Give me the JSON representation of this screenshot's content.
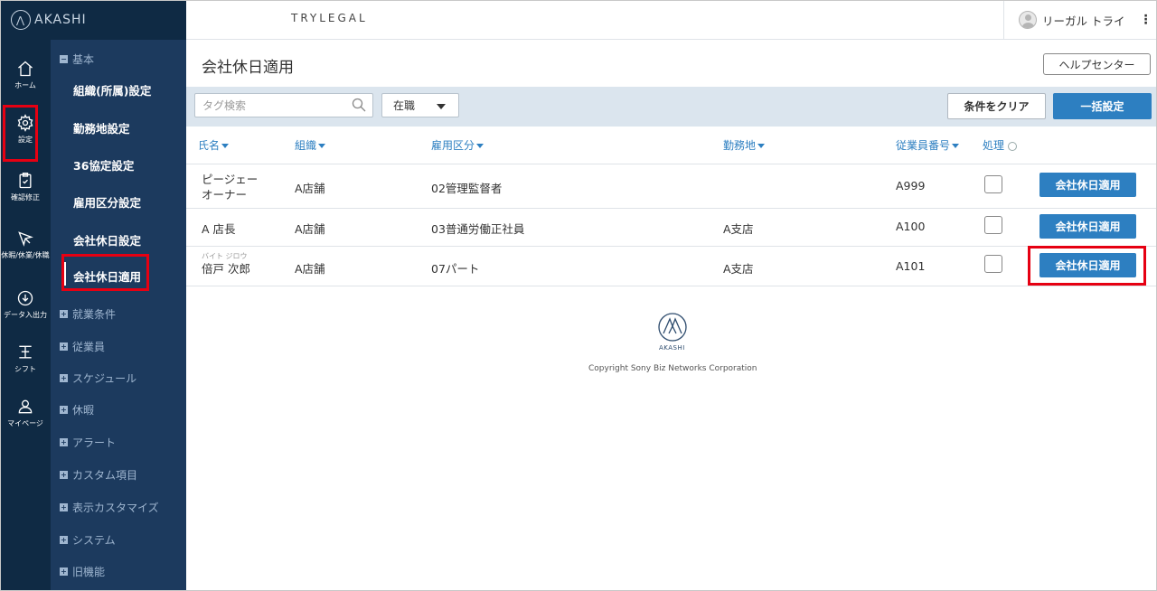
{
  "app": {
    "brand": "AKASHI",
    "company": "TRYLEGAL"
  },
  "user": {
    "name": "リーガル トライ",
    "menu_icon": "kebab-icon"
  },
  "rail": {
    "items": [
      {
        "label": "ホーム",
        "icon": "home-icon"
      },
      {
        "label": "設定",
        "icon": "gear-icon"
      },
      {
        "label": "確認修正",
        "icon": "clipboard-icon"
      },
      {
        "label": "休暇/休業/休職",
        "icon": "plane-icon"
      },
      {
        "label": "データ入出力",
        "icon": "download-icon"
      },
      {
        "label": "シフト",
        "icon": "shift-icon"
      },
      {
        "label": "マイページ",
        "icon": "person-icon"
      }
    ]
  },
  "subnav": {
    "section_basic": "基本",
    "items": [
      "組織(所属)設定",
      "勤務地設定",
      "36協定設定",
      "雇用区分設定",
      "会社休日設定",
      "会社休日適用"
    ],
    "sections": [
      "就業条件",
      "従業員",
      "スケジュール",
      "休暇",
      "アラート",
      "カスタム項目",
      "表示カスタマイズ",
      "システム",
      "旧機能"
    ]
  },
  "page": {
    "title": "会社休日適用",
    "help_label": "ヘルプセンター"
  },
  "filters": {
    "search_placeholder": "タグ検索",
    "status_value": "在職",
    "clear_label": "条件をクリア",
    "bulk_label": "一括設定"
  },
  "table": {
    "headers": {
      "name": "氏名",
      "org": "組織",
      "employment": "雇用区分",
      "workplace": "勤務地",
      "emp_no": "従業員番号",
      "process": "処理"
    },
    "rows": [
      {
        "ruby": "",
        "name_line1": "ピージェー",
        "name_line2": "オーナー",
        "org": "A店舗",
        "employment": "02管理監督者",
        "workplace": "",
        "emp_no": "A999",
        "action": "会社休日適用"
      },
      {
        "ruby": "",
        "name_line1": "A 店長",
        "name_line2": "",
        "org": "A店舗",
        "employment": "03普通労働正社員",
        "workplace": "A支店",
        "emp_no": "A100",
        "action": "会社休日適用"
      },
      {
        "ruby": "バイト ジロウ",
        "name_line1": "倍戸 次郎",
        "name_line2": "",
        "org": "A店舗",
        "employment": "07パート",
        "workplace": "A支店",
        "emp_no": "A101",
        "action": "会社休日適用"
      }
    ]
  },
  "footer": {
    "logo_text": "AKASHI",
    "copyright": "Copyright Sony Biz Networks Corporation"
  },
  "colors": {
    "rail": "#0f2a44",
    "subnav": "#1c3a5e",
    "accent": "#2d7fc1",
    "highlight": "#e60012",
    "filterbar": "#dbe5ee"
  }
}
